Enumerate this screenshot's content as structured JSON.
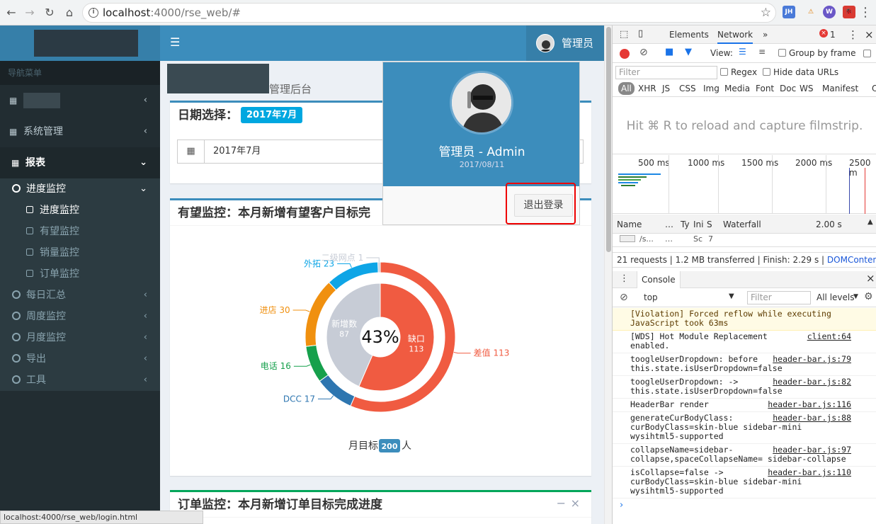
{
  "browser": {
    "url_host": "localhost",
    "url_path": ":4000/rse_web/#",
    "status_url": "localhost:4000/rse_web/login.html",
    "ext": [
      "JH",
      "⚠",
      "W",
      "🐞"
    ]
  },
  "sidebar": {
    "nav_header": "导航菜单",
    "items": [
      {
        "label": "系统管理"
      },
      {
        "label": "报表"
      }
    ],
    "progress_group": "进度监控",
    "progress_sub": [
      "进度监控",
      "有望监控",
      "销量监控",
      "订单监控"
    ],
    "other_groups": [
      "每日汇总",
      "周度监控",
      "月度监控",
      "导出",
      "工具"
    ]
  },
  "topbar": {
    "user": "管理员"
  },
  "page": {
    "title_suffix": "管理后台"
  },
  "date_box": {
    "title": "日期选择：",
    "badge": "2017年7月",
    "value": "2017年7月"
  },
  "prospect_box": {
    "title": "有望监控：本月新增有望客户目标完"
  },
  "order_box": {
    "title": "订单监控：本月新增订单目标完成进度"
  },
  "dropdown": {
    "name": "管理员 - Admin",
    "date": "2017/08/11",
    "logout": "退出登录"
  },
  "chart_data": {
    "type": "pie",
    "center_label": "43%",
    "outer_ring": [
      {
        "name": "差值",
        "value": 113,
        "color": "#f05b41"
      },
      {
        "name": "DCC",
        "value": 17,
        "color": "#2e76b0"
      },
      {
        "name": "电话",
        "value": 16,
        "color": "#16a04c"
      },
      {
        "name": "进店",
        "value": 30,
        "color": "#f0900f"
      },
      {
        "name": "外拓",
        "value": 23,
        "color": "#0ea5e6"
      },
      {
        "name": "二级网点",
        "value": 1,
        "color": "#c7ccd6"
      }
    ],
    "inner_ring": [
      {
        "name": "缺口",
        "value": 113,
        "color": "#f05b41"
      },
      {
        "name": "新增数",
        "value": 87,
        "color": "#c7ccd6"
      }
    ],
    "target_prefix": "月目标",
    "target_value": "200",
    "target_suffix": "人"
  },
  "devtools": {
    "tabs": [
      "Elements",
      "Network"
    ],
    "error_count": "1",
    "view_label": "View:",
    "group_by_frame": "Group by frame",
    "filter_placeholder": "Filter",
    "regex": "Regex",
    "hide_data_urls": "Hide data URLs",
    "types": [
      "All",
      "XHR",
      "JS",
      "CSS",
      "Img",
      "Media",
      "Font",
      "Doc",
      "WS",
      "Manifest",
      "Oth"
    ],
    "hint": "Hit ⌘ R to reload and capture filmstrip.",
    "timeline": [
      "500 ms",
      "1000 ms",
      "1500 ms",
      "2000 ms",
      "2500 m"
    ],
    "col_name": "Name",
    "col_dots": "…",
    "col_ty": "Ty",
    "col_ini": "Ini",
    "col_s": "S",
    "col_waterfall": "Waterfall",
    "col_time": "2.00 s",
    "row_name": "/s...",
    "row_dots": "…",
    "row_sc": "Sc",
    "row_seven": "7",
    "summary": "21 requests | 1.2 MB transferred | Finish: 2.29 s | ",
    "dcl": "DOMContentLoa...",
    "console_tab": "Console",
    "context": "top",
    "level": "All levels",
    "console": [
      {
        "msg": "[Violation] Forced reflow while executing\nJavaScript took 63ms",
        "src": "",
        "warn": true
      },
      {
        "msg": "[WDS] Hot Module Replacement\nenabled.",
        "src": "client:64"
      },
      {
        "msg": "toogleUserDropdown: before\nthis.state.isUserDropdown=false",
        "src": "header-bar.js:79"
      },
      {
        "msg": "toogleUserDropdown: ->\nthis.state.isUserDropdown=false",
        "src": "header-bar.js:82"
      },
      {
        "msg": "HeaderBar render",
        "src": "header-bar.js:116"
      },
      {
        "msg": "generateCurBodyClass:\ncurBodyClass=skin-blue sidebar-mini\nwysihtml5-supported",
        "src": "header-bar.js:88"
      },
      {
        "msg": "collapseName=sidebar-\ncollapse,spaceCollapseName= sidebar-collapse",
        "src": "header-bar.js:97"
      },
      {
        "msg": "isCollapse=false ->\ncurBodyClass=skin-blue sidebar-mini\nwysihtml5-supported",
        "src": "header-bar.js:110"
      }
    ]
  }
}
